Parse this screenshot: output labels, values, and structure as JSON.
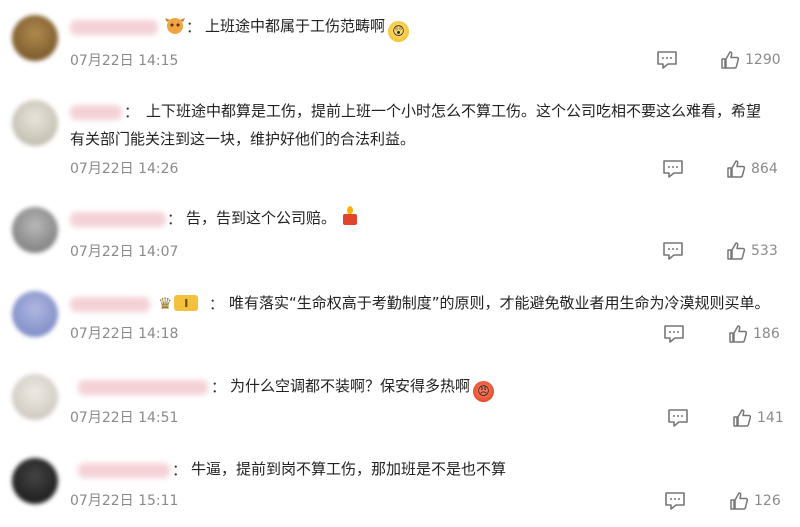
{
  "comments": [
    {
      "text": "上班途中都属于工伤范畴啊",
      "emoji": "shock",
      "time": "07月22日 14:15",
      "likes": "1290",
      "avatar_color": "#8a6a3a"
    },
    {
      "text": "上下班途中都算是工伤，提前上班一个小时怎么不算工伤。这个公司吃相不要这么难看，希望",
      "text2": "有关部门能关注到这一块，维护好他们的合法利益。",
      "time": "07月22日 14:26",
      "likes": "864",
      "avatar_color": "#c8c2b4"
    },
    {
      "text": "告，告到这个公司赔。",
      "emoji": "candle",
      "time": "07月22日 14:07",
      "likes": "533",
      "avatar_color": "#9a9a9a"
    },
    {
      "text": "唯有落实“生命权高于考勤制度”的原则，才能避免敬业者用生命为冷漠规则买单。",
      "badge_level": "I",
      "time": "07月22日 14:18",
      "likes": "186",
      "avatar_color": "#8a96c8"
    },
    {
      "text": "为什么空调都不装啊？保安得多热啊",
      "emoji": "angry",
      "time": "07月22日 14:51",
      "likes": "141",
      "avatar_color": "#d6d2cc"
    },
    {
      "text": "牛逼，提前到岗不算工伤，那加班是不是也不算",
      "time": "07月22日 15:11",
      "likes": "126",
      "avatar_color": "#2a2a2a"
    }
  ],
  "ui": {
    "colon": "：",
    "accent_name_color": "#f2c9cf",
    "meta_color": "#8a8a8a"
  }
}
